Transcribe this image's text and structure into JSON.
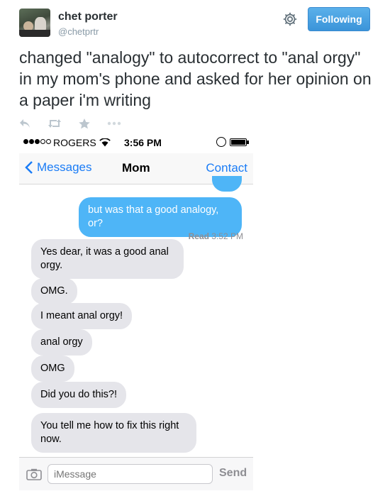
{
  "tweet": {
    "display_name": "chet porter",
    "handle": "@chetprtr",
    "follow_label": "Following",
    "text": "changed \"analogy\" to autocorrect to \"anal orgy\" in my mom's phone and asked for her opinion on a paper i'm writing",
    "actions": [
      {
        "icon": "reply-icon"
      },
      {
        "icon": "retweet-icon"
      },
      {
        "icon": "favorite-icon"
      },
      {
        "icon": "more-icon"
      }
    ]
  },
  "phone": {
    "status": {
      "carrier": "ROGERS",
      "time": "3:56 PM"
    },
    "nav": {
      "back_label": "Messages",
      "title": "Mom",
      "right_label": "Contact"
    },
    "read_receipt": {
      "label": "Read",
      "time": "3:52 PM"
    },
    "messages": [
      {
        "direction": "out",
        "text": "but was that a good analogy, or?"
      },
      {
        "direction": "in",
        "text": "Yes dear, it was a good anal orgy."
      },
      {
        "direction": "in",
        "text": "OMG."
      },
      {
        "direction": "in",
        "text": "I meant anal orgy!"
      },
      {
        "direction": "in",
        "text": "anal orgy"
      },
      {
        "direction": "in",
        "text": "OMG"
      },
      {
        "direction": "in",
        "text": "Did you do this?!"
      },
      {
        "direction": "in",
        "text": "You tell me how to fix this right now."
      }
    ],
    "composer": {
      "placeholder": "iMessage",
      "send_label": "Send"
    }
  },
  "colors": {
    "accent_blue": "#1a7cf6",
    "outgoing_bubble": "#4eb5f7",
    "incoming_bubble": "#e5e5ea",
    "follow_button": "#3b94d9"
  }
}
